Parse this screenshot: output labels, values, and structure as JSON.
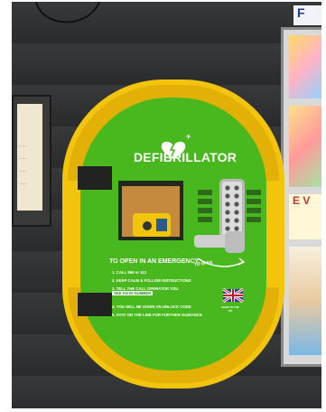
{
  "cabinet": {
    "brand": "DEFIBRILLATOR",
    "emergency_heading": "TO OPEN IN AN EMERGENCY:",
    "steps": [
      "1. CALL 999 or 112",
      "2. KEEP CALM & FOLLOW INSTRUCTIONS",
      "3. TELL THE CALL OPERATOR YOU",
      "SEE AN ID NUMBER",
      "4. YOU WILL BE GIVEN AN UNLOCK CODE",
      "5. STAY ON THE LINE FOR FURTHER GUIDANCE"
    ],
    "overlay_text": "TO OPEN",
    "made_in": "MADE IN THE UK"
  },
  "board": {
    "corner_letter": "F",
    "poster_letters": "E V"
  },
  "colors": {
    "cabinet_yellow": "#f2c40c",
    "panel_green": "#49b81e",
    "wall": "#2c2d2f",
    "hinge": "#222222",
    "handle": "#cfcfcf"
  },
  "icons": [
    "heart-lightning-icon",
    "union-jack-icon",
    "keypad-icon",
    "hinge-icon"
  ]
}
